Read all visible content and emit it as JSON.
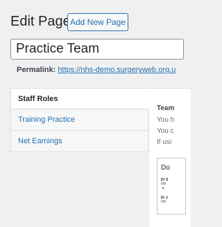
{
  "header": {
    "title": "Edit Page",
    "add_new_label": "Add New Page"
  },
  "post_title": {
    "value": "Practice Team"
  },
  "permalink": {
    "label": "Permalink:",
    "url": "https://nhs-demo.surgeryweb.org.u"
  },
  "tabs": [
    {
      "label": "Staff Roles",
      "active": true
    },
    {
      "label": "Training Practice",
      "active": false
    },
    {
      "label": "Net Earnings",
      "active": false
    }
  ],
  "content": {
    "heading": "Team",
    "lines": [
      "You h",
      "You c",
      "If usi"
    ]
  },
  "preview": {
    "title": "Do",
    "items": [
      {
        "name": "Dr S",
        "quals": "MB",
        "marker": "►"
      },
      {
        "name": "Dr J",
        "quals": "MB",
        "marker": ""
      }
    ]
  },
  "colors": {
    "background": "#f0f0f1",
    "accent": "#2271b1",
    "text": "#1d2327"
  }
}
